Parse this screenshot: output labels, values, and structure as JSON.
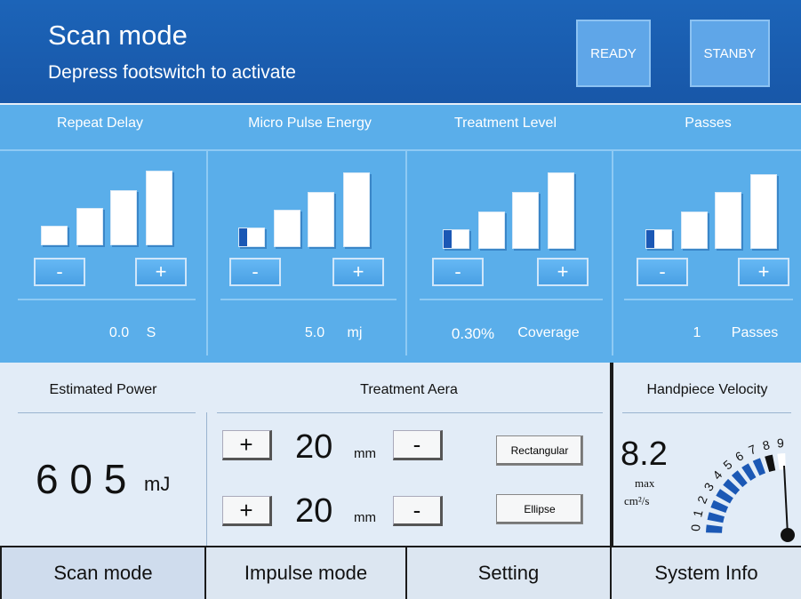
{
  "header": {
    "title": "Scan mode",
    "subtitle": "Depress footswitch to activate",
    "ready_label": "READY",
    "standby_label": "STANBY"
  },
  "controls": [
    {
      "label": "Repeat Delay",
      "value": "0.0",
      "unit": "S",
      "minus": "-",
      "plus": "+",
      "level_indicator": false
    },
    {
      "label": "Micro Pulse Energy",
      "value": "5.0",
      "unit": "mj",
      "minus": "-",
      "plus": "+",
      "level_indicator": true
    },
    {
      "label": "Treatment Level",
      "value": "0.30%",
      "unit": "Coverage",
      "minus": "-",
      "plus": "+",
      "level_indicator": true
    },
    {
      "label": "Passes",
      "value": "1",
      "unit": "Passes",
      "minus": "-",
      "plus": "+",
      "level_indicator": true
    }
  ],
  "estimated_power": {
    "label": "Estimated Power",
    "value": "6 0 5",
    "unit": "mJ"
  },
  "treatment_area": {
    "label": "Treatment Aera",
    "rows": [
      {
        "plus": "+",
        "value": "20",
        "unit": "mm",
        "minus": "-"
      },
      {
        "plus": "+",
        "value": "20",
        "unit": "mm",
        "minus": "-"
      }
    ],
    "shape_rectangular": "Rectangular",
    "shape_ellipse": "Ellipse"
  },
  "handpiece_velocity": {
    "label": "Handpiece Velocity",
    "value": "8.2",
    "max_label": "max",
    "unit": "cm²/s",
    "scale": [
      "0",
      "1",
      "2",
      "3",
      "4",
      "5",
      "6",
      "7",
      "8",
      "9"
    ],
    "level": 8.2
  },
  "tabs": [
    "Scan mode",
    "Impulse mode",
    "Setting",
    "System Info"
  ],
  "colors": {
    "header_blue": "#1c64b8",
    "panel_blue": "#5aaeea",
    "gauge_blue": "#1b58b5",
    "lower_panel": "#e2ecf7"
  }
}
